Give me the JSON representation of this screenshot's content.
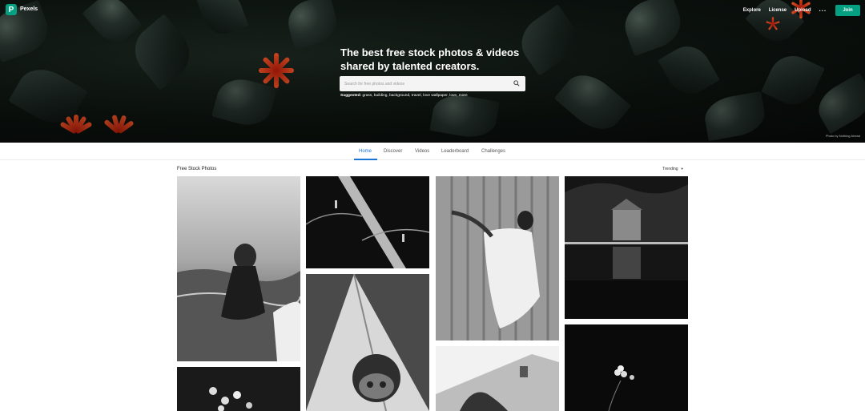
{
  "header": {
    "logo_letter": "P",
    "brand": "Pexels",
    "nav": [
      "Explore",
      "License",
      "Upload"
    ],
    "more_label": "···",
    "join_label": "Join"
  },
  "hero": {
    "headline_line1": "The best free stock photos & videos",
    "headline_line2": "shared by talented creators.",
    "search_placeholder": "Search for free photos and videos",
    "suggested_label": "Suggested:",
    "suggested_terms": "grass, building, background, travel, love wallpaper, love, more",
    "photo_credit": "Photo by Nothing Ahead"
  },
  "tabs": [
    "Home",
    "Discover",
    "Videos",
    "Leaderboard",
    "Challenges"
  ],
  "active_tab": "Home",
  "section": {
    "title": "Free Stock Photos",
    "sort_label": "Trending",
    "sort_caret": "▼"
  },
  "colors": {
    "accent": "#05a081",
    "active_tab": "#1a74d4"
  }
}
